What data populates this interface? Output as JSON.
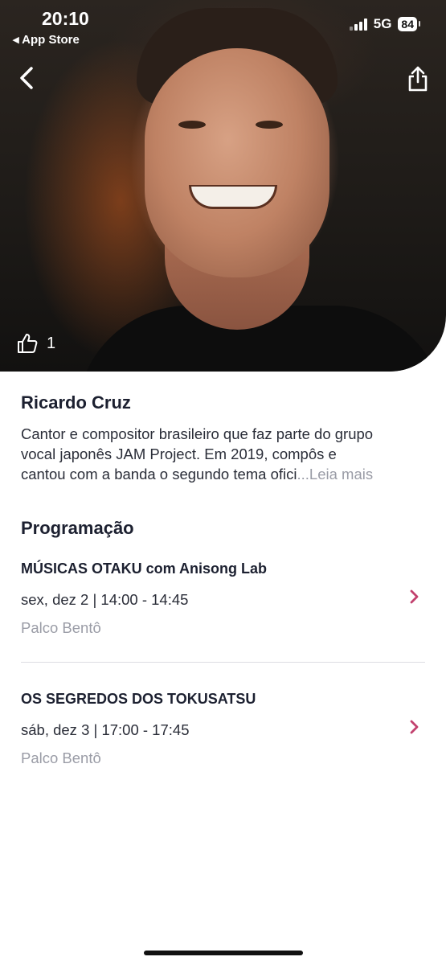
{
  "status_bar": {
    "time": "20:10",
    "back_app": "◂ App Store",
    "network": "5G",
    "battery": "84"
  },
  "hero": {
    "like_count": "1"
  },
  "artist": {
    "name": "Ricardo Cruz",
    "bio_lines": [
      "Cantor e compositor brasileiro que faz parte do grupo",
      "vocal japonês JAM Project. Em 2019, compôs e",
      "cantou com a banda o segundo tema ofici"
    ],
    "read_more": "...Leia mais"
  },
  "schedule": {
    "title": "Programação",
    "events": [
      {
        "title": "MÚSICAS OTAKU com Anisong Lab",
        "time": "sex, dez 2 | 14:00 - 14:45",
        "venue": "Palco Bentô"
      },
      {
        "title": "OS SEGREDOS DOS TOKUSATSU",
        "time": "sáb, dez 3 | 17:00 - 17:45",
        "venue": "Palco Bentô"
      }
    ]
  },
  "colors": {
    "accent": "#c2416e",
    "text_primary": "#1c2030",
    "text_muted": "#9a9ca6"
  },
  "icons": [
    "back-arrow-icon",
    "share-icon",
    "thumbs-up-icon",
    "chevron-right-icon",
    "signal-icon",
    "battery-icon"
  ]
}
